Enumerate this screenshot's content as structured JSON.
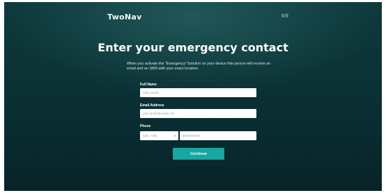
{
  "brand": {
    "logo": "TwoNav"
  },
  "progress": {
    "step_text": "6/9"
  },
  "page": {
    "title": "Enter your emergency contact",
    "description": "When you activate the \"Emergency\" function on your device this person will receive an email and an SMS with your exact location."
  },
  "form": {
    "full_name": {
      "label": "Full Name",
      "placeholder": "John Smith"
    },
    "email": {
      "label": "Email Address",
      "placeholder": "john.smith@email.com"
    },
    "phone": {
      "label": "Phone",
      "country_value": "Italy (+39)",
      "placeholder": "6604023684"
    },
    "submit_label": "Continue"
  },
  "colors": {
    "background": "#0c3539",
    "accent": "#18a7a2"
  },
  "icons": {
    "country_dropdown": "chevron-down-icon"
  }
}
